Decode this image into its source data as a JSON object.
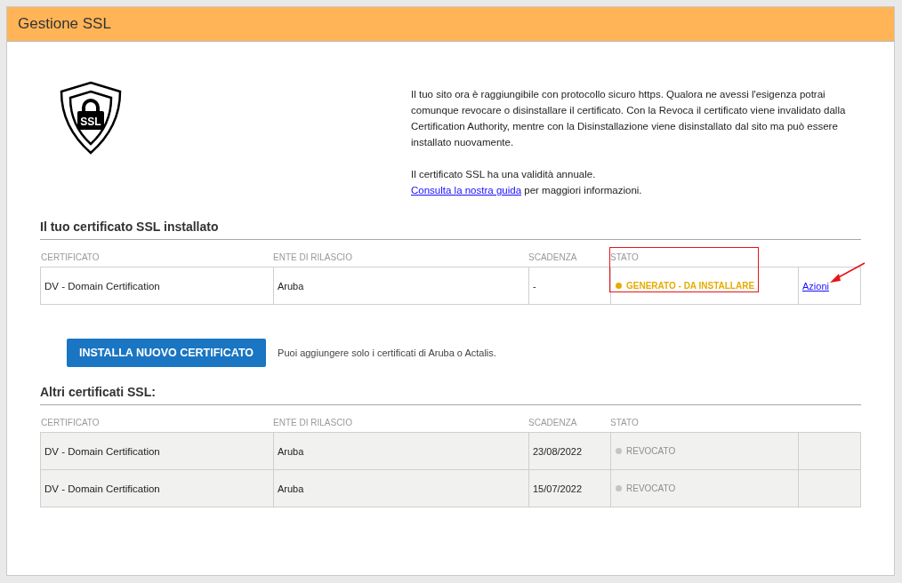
{
  "header": {
    "title": "Gestione SSL"
  },
  "shield_label": "SSL",
  "intro": {
    "paragraph": "Il tuo sito ora è raggiungibile con protocollo sicuro https. Qualora ne avessi l'esigenza potrai comunque revocare o disinstallare il certificato. Con la Revoca il certificato viene invalidato dalla Certification Authority, mentre con la Disinstallazione viene disinstallato dal sito ma può essere installato nuovamente.",
    "validity": "Il certificato SSL ha una validità annuale.",
    "guide_link": "Consulta la nostra guida",
    "guide_rest": "per maggiori informazioni."
  },
  "installed": {
    "title": "Il tuo certificato SSL installato",
    "columns": [
      "CERTIFICATO",
      "ENTE DI RILASCIO",
      "SCADENZA",
      "STATO"
    ],
    "status_column_highlighted": true,
    "rows": [
      {
        "certificate": "DV - Domain Certification",
        "issuer": "Aruba",
        "expiry": "-",
        "status": "GENERATO - DA INSTALLARE",
        "active": true,
        "color": "#e6ac00",
        "action": "Azioni",
        "pointed": true
      }
    ]
  },
  "install_button": "INSTALLA NUOVO CERTIFICATO",
  "install_note": "Puoi aggiungere solo i certificati di Aruba o Actalis.",
  "others": {
    "title": "Altri certificati SSL:",
    "columns": [
      "CERTIFICATO",
      "ENTE DI RILASCIO",
      "SCADENZA",
      "STATO"
    ],
    "rows": [
      {
        "certificate": "DV - Domain Certification",
        "issuer": "Aruba",
        "expiry": "23/08/2022",
        "status": "REVOCATO",
        "active": false,
        "color": "#c4c4c4",
        "pointed": false
      },
      {
        "certificate": "DV - Domain Certification",
        "issuer": "Aruba",
        "expiry": "15/07/2022",
        "status": "REVOCATO",
        "active": false,
        "color": "#c4c4c4",
        "pointed": false
      }
    ]
  }
}
